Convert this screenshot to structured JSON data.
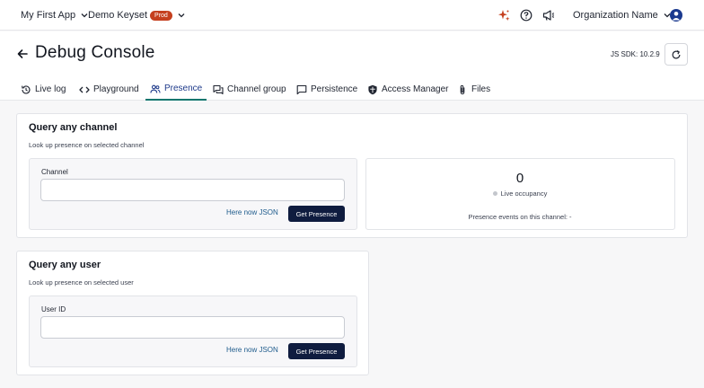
{
  "topbar": {
    "app_name": "My First App",
    "keyset_name": "Demo Keyset",
    "keyset_badge": "Prod",
    "org_name": "Organization Name",
    "icons": [
      "sparkle-icon",
      "help-icon",
      "announcement-icon",
      "user-avatar-icon"
    ],
    "accent_color": "#c5401f"
  },
  "header": {
    "title": "Debug Console",
    "sdk_version": "JS SDK: 10.2.9"
  },
  "tabs": [
    {
      "label": "Live log",
      "icon": "history-icon"
    },
    {
      "label": "Playground",
      "icon": "code-icon"
    },
    {
      "label": "Presence",
      "icon": "people-icon",
      "active": true
    },
    {
      "label": "Channel group",
      "icon": "chat-group-icon"
    },
    {
      "label": "Persistence",
      "icon": "message-icon"
    },
    {
      "label": "Access Manager",
      "icon": "shield-icon"
    },
    {
      "label": "Files",
      "icon": "paperclip-icon"
    }
  ],
  "channel_query": {
    "title": "Query any channel",
    "subtitle": "Look up presence on selected channel",
    "field_label": "Channel",
    "field_value": "",
    "here_now_label": "Here now JSON",
    "get_presence_label": "Get Presence",
    "occupancy_value": "0",
    "occupancy_label": "Live occupancy",
    "events_text": "Presence events on this channel: -"
  },
  "user_query": {
    "title": "Query any user",
    "subtitle": "Look up presence on selected user",
    "field_label": "User ID",
    "field_value": "",
    "here_now_label": "Here now JSON",
    "get_presence_label": "Get Presence"
  },
  "colors": {
    "primary_button": "#0f1c3f",
    "active_tab_underline": "#0f766e",
    "link": "#1e5b8c"
  }
}
